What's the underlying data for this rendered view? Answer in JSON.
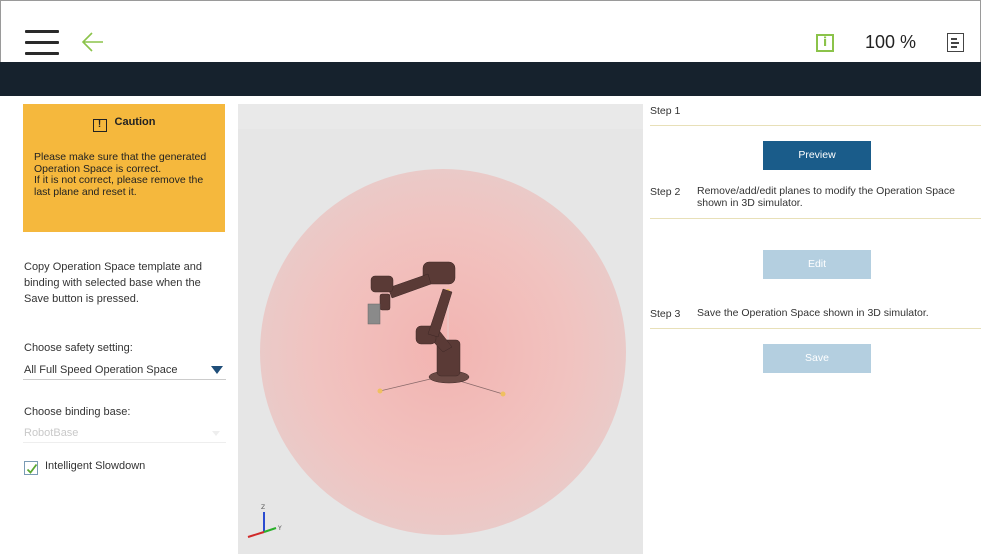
{
  "header": {
    "menu_icon": "hamburger-menu-icon",
    "back_icon": "back-arrow-icon",
    "info_icon": "info-icon",
    "zoom": "100 %",
    "doc_icon": "document-icon",
    "accent_color": "#8bc34a",
    "bar_color": "#16222d"
  },
  "caution": {
    "title": "Caution",
    "message": "Please make sure that the generated Operation Space is correct.\nIf it is not correct, please remove the last plane and reset it.",
    "color": "#f5b83d"
  },
  "left": {
    "copy_text": "Copy Operation Space template and binding with selected base when the Save button is pressed.",
    "safety_label": "Choose safety setting:",
    "safety_value": "All Full Speed Operation Space",
    "base_label": "Choose binding base:",
    "base_value": "RobotBase",
    "slowdown_label": "Intelligent Slowdown",
    "slowdown_checked": true
  },
  "steps": [
    {
      "num": "Step 1",
      "desc": "",
      "button": "Preview"
    },
    {
      "num": "Step 2",
      "desc": "Remove/add/edit planes to modify the Operation Space shown in 3D simulator.",
      "button": "Edit"
    },
    {
      "num": "Step 3",
      "desc": "Save the Operation Space shown in 3D simulator.",
      "button": "Save"
    }
  ],
  "button_colors": {
    "active": "#1a5c8a",
    "disabled": "#b4cfe0"
  }
}
